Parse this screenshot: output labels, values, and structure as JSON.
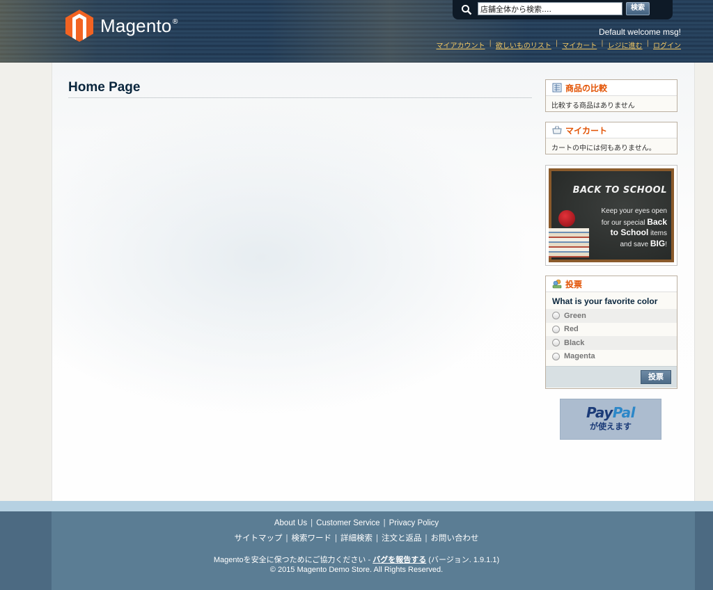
{
  "header": {
    "logo_text": "Magento",
    "logo_reg": "®",
    "search": {
      "placeholder": "店舗全体から検索....",
      "button_label": "検索"
    },
    "welcome": "Default welcome msg!",
    "links": [
      "マイアカウント",
      "欲しいものリスト",
      "マイカート",
      "レジに進む",
      "ログイン"
    ]
  },
  "main": {
    "page_title": "Home Page"
  },
  "sidebar": {
    "compare": {
      "title": "商品の比較",
      "body": "比較する商品はありません"
    },
    "cart": {
      "title": "マイカート",
      "body": "カートの中には何もありません。"
    },
    "promo": {
      "headline": "BACK TO SCHOOL",
      "line1": "Keep your eyes open",
      "line2_a": "for our special ",
      "line2_b": "Back",
      "line3_a": "to School",
      "line3_b": " items",
      "line4_a": "and save ",
      "line4_b": "BIG",
      "line4_c": "!"
    },
    "poll": {
      "title": "投票",
      "question": "What is your favorite color",
      "options": [
        "Green",
        "Red",
        "Black",
        "Magenta"
      ],
      "vote_label": "投票"
    },
    "paypal": {
      "logo_pay": "Pay",
      "logo_pal": "Pal",
      "sub": "が使えます"
    }
  },
  "footer": {
    "row1": [
      "About Us",
      "Customer Service",
      "Privacy Policy"
    ],
    "row2": [
      "サイトマップ",
      "検索ワード",
      "詳細検索",
      "注文と返品",
      "お問い合わせ"
    ],
    "notice_pre": "Magentoを安全に保つためにご協力ください - ",
    "notice_link": "バグを報告する",
    "notice_post": " (バージョン. 1.9.1.1)",
    "copyright": "© 2015 Magento Demo Store. All Rights Reserved."
  },
  "colors": {
    "accent_orange": "#e25203",
    "header_dark": "#1f354d",
    "footer_blue": "#5b7d94",
    "link_gold": "#f3c862"
  },
  "icons": [
    "magento-logo-icon",
    "search-icon",
    "compare-icon",
    "cart-icon",
    "poll-icon"
  ]
}
